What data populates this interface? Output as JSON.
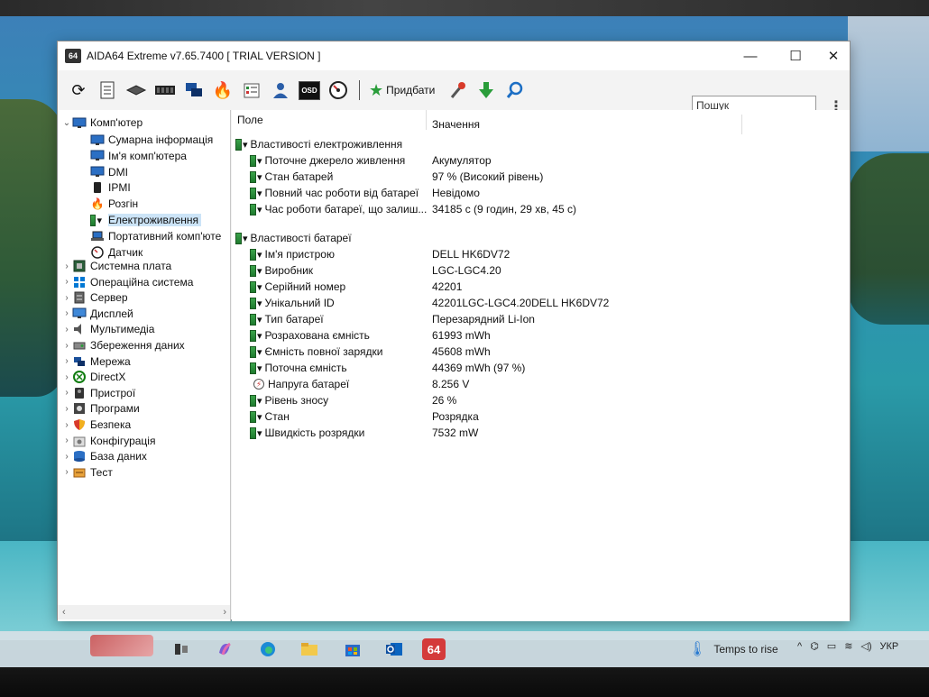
{
  "window": {
    "title": "AIDA64 Extreme v7.65.7400  [ TRIAL VERSION ]",
    "app_icon_text": "64",
    "controls": {
      "minimize": "—",
      "maximize": "☐",
      "close": "✕"
    }
  },
  "toolbar": {
    "add_label": "Придбати",
    "osd_label": "OSD",
    "search_placeholder": "Пошук"
  },
  "tree": {
    "root_label": "Комп'ютер",
    "children": [
      {
        "label": "Сумарна інформація",
        "icon": "monitor-icon"
      },
      {
        "label": "Ім'я комп'ютера",
        "icon": "monitor-icon"
      },
      {
        "label": "DMI",
        "icon": "monitor-icon"
      },
      {
        "label": "IPMI",
        "icon": "phone-icon"
      },
      {
        "label": "Розгін",
        "icon": "fire-icon"
      },
      {
        "label": "Електроживлення",
        "icon": "battery-plug-icon",
        "selected": true
      },
      {
        "label": "Портативний комп'юте",
        "icon": "laptop-icon"
      },
      {
        "label": "Датчик",
        "icon": "gauge-icon"
      }
    ],
    "sections": [
      {
        "label": "Системна плата",
        "icon": "motherboard-icon"
      },
      {
        "label": "Операційна система",
        "icon": "windows-icon"
      },
      {
        "label": "Сервер",
        "icon": "server-icon"
      },
      {
        "label": "Дисплей",
        "icon": "display-icon"
      },
      {
        "label": "Мультимедіа",
        "icon": "speaker-icon"
      },
      {
        "label": "Збереження даних",
        "icon": "storage-icon"
      },
      {
        "label": "Мережа",
        "icon": "network-icon"
      },
      {
        "label": "DirectX",
        "icon": "xbox-icon"
      },
      {
        "label": "Пристрої",
        "icon": "devices-icon"
      },
      {
        "label": "Програми",
        "icon": "programs-icon"
      },
      {
        "label": "Безпека",
        "icon": "shield-icon"
      },
      {
        "label": "Конфігурація",
        "icon": "config-icon"
      },
      {
        "label": "База даних",
        "icon": "database-icon"
      },
      {
        "label": "Тест",
        "icon": "test-icon"
      }
    ]
  },
  "table": {
    "headers": {
      "field": "Поле",
      "value": "Значення"
    },
    "groups": [
      {
        "title": "Властивості електроживлення",
        "rows": [
          {
            "field": "Поточне джерело живлення",
            "value": "Акумулятор"
          },
          {
            "field": "Стан батарей",
            "value": "97 % (Високий рівень)"
          },
          {
            "field": "Повний час роботи від батареї",
            "value": "Невідомо"
          },
          {
            "field": "Час роботи батареї, що залиш...",
            "value": "34185 с (9 годин, 29 хв, 45 с)"
          }
        ]
      },
      {
        "title": "Властивості батареї",
        "rows": [
          {
            "field": "Ім'я пристрою",
            "value": "DELL HK6DV72"
          },
          {
            "field": "Виробник",
            "value": "LGC-LGC4.20"
          },
          {
            "field": "Серійний номер",
            "value": "42201"
          },
          {
            "field": "Унікальний ID",
            "value": "42201LGC-LGC4.20DELL HK6DV72"
          },
          {
            "field": "Тип батареї",
            "value": "Перезарядний Li-Ion"
          },
          {
            "field": "Розрахована ємність",
            "value": "61993 mWh"
          },
          {
            "field": "Ємність повної зарядки",
            "value": "45608 mWh"
          },
          {
            "field": "Поточна ємність",
            "value": "44369 mWh  (97 %)"
          },
          {
            "field": "Напруга батареї",
            "value": "8.256 V"
          },
          {
            "field": "Рівень зносу",
            "value": "26 %"
          },
          {
            "field": "Стан",
            "value": "Розрядка"
          },
          {
            "field": "Швидкість розрядки",
            "value": "7532 mW"
          }
        ]
      }
    ]
  },
  "taskbar": {
    "weather": "Temps to rise",
    "language": "УКР",
    "aida_label": "64"
  }
}
